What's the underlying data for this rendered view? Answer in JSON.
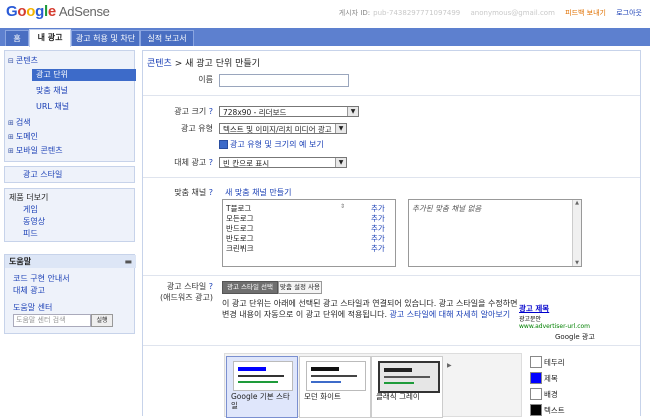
{
  "header": {
    "logo_letters": [
      "G",
      "o",
      "o",
      "g",
      "l",
      "e"
    ],
    "product": "AdSense",
    "publisher_id_label": "게시자 ID:",
    "publisher_id_value": "pub-7438297771097499",
    "email": "anonymous@gmail.com",
    "feedback": "피드백 보내기",
    "logout": "로그아웃"
  },
  "tabs": [
    {
      "label": "홈"
    },
    {
      "label": "내 광고"
    },
    {
      "label": "광고 허용 및 차단"
    },
    {
      "label": "실적 보고서"
    }
  ],
  "sidebar": {
    "content_label": "콘텐츠",
    "ad_units": "광고 단위",
    "custom_channels": "맞춤 채널",
    "url_channels": "URL 채널",
    "search": "검색",
    "domains": "도메인",
    "mobile_content": "모바일 콘텐츠",
    "ad_styles": "광고 스타일",
    "more_products_title": "제품 더보기",
    "games": "게임",
    "video": "동영상",
    "feeds": "피드",
    "help_title": "도움말",
    "code_guide": "코드 구현 안내서",
    "custom_ads": "대체 광고",
    "help_center": "도움말 센터",
    "help_search_placeholder": "도움말 센터 검색",
    "help_search_button": "실행"
  },
  "main": {
    "breadcrumb_link": "콘텐츠",
    "breadcrumb_sep": ">",
    "breadcrumb_current": "새 광고 단위 만들기",
    "name_label": "이름",
    "name_value": "",
    "ad_size_label": "광고 크기",
    "ad_size_value": "728x90 - 리더보드",
    "ad_type_label": "광고 유형",
    "ad_type_value": "텍스트 및 이미지/리치 미디어 광고",
    "ad_type_link": "광고 유형 및 크기의 예 보기",
    "backup_label": "대체 광고",
    "backup_value": "빈 칸으로 표시",
    "channels_label": "맞춤 채널",
    "new_channel_link": "새 맞춤 채널 만들기",
    "channels": [
      "T블로그",
      "모든로그",
      "반드로그",
      "반도로그",
      "크린뷔크"
    ],
    "add_label": "추가",
    "added_channels_empty": "추가된 맞춤 채널 없음",
    "style_label": "광고 스타일",
    "style_sublabel": "(애드워즈 광고)",
    "style_btn_select": "광고 스타일 선택",
    "style_btn_custom": "맞춤 설정 사용",
    "style_info_1": "이 광고 단위는 아래에 선택된 광고 스타일과 연결되어 있습니다. 광고 스타일을 수정하면",
    "style_info_2": "변경 내용이 자동으로 이 광고 단위에 적용됩니다.",
    "style_info_link": "광고 스타일에 대해 자세히 알아보기",
    "sample_title": "광고 제목",
    "sample_text": "광고문안",
    "sample_url": "www.advertiser-url.com",
    "sample_by": "Google 광고",
    "styles": [
      {
        "name": "Google 기본 스타일"
      },
      {
        "name": "모던 화이트"
      },
      {
        "name": "클래식 그레이"
      }
    ],
    "colors": [
      {
        "label": "테두리",
        "color": "#ffffff"
      },
      {
        "label": "제목",
        "color": "#0000ff"
      },
      {
        "label": "배경",
        "color": "#ffffff"
      },
      {
        "label": "텍스트",
        "color": "#000000"
      }
    ]
  }
}
